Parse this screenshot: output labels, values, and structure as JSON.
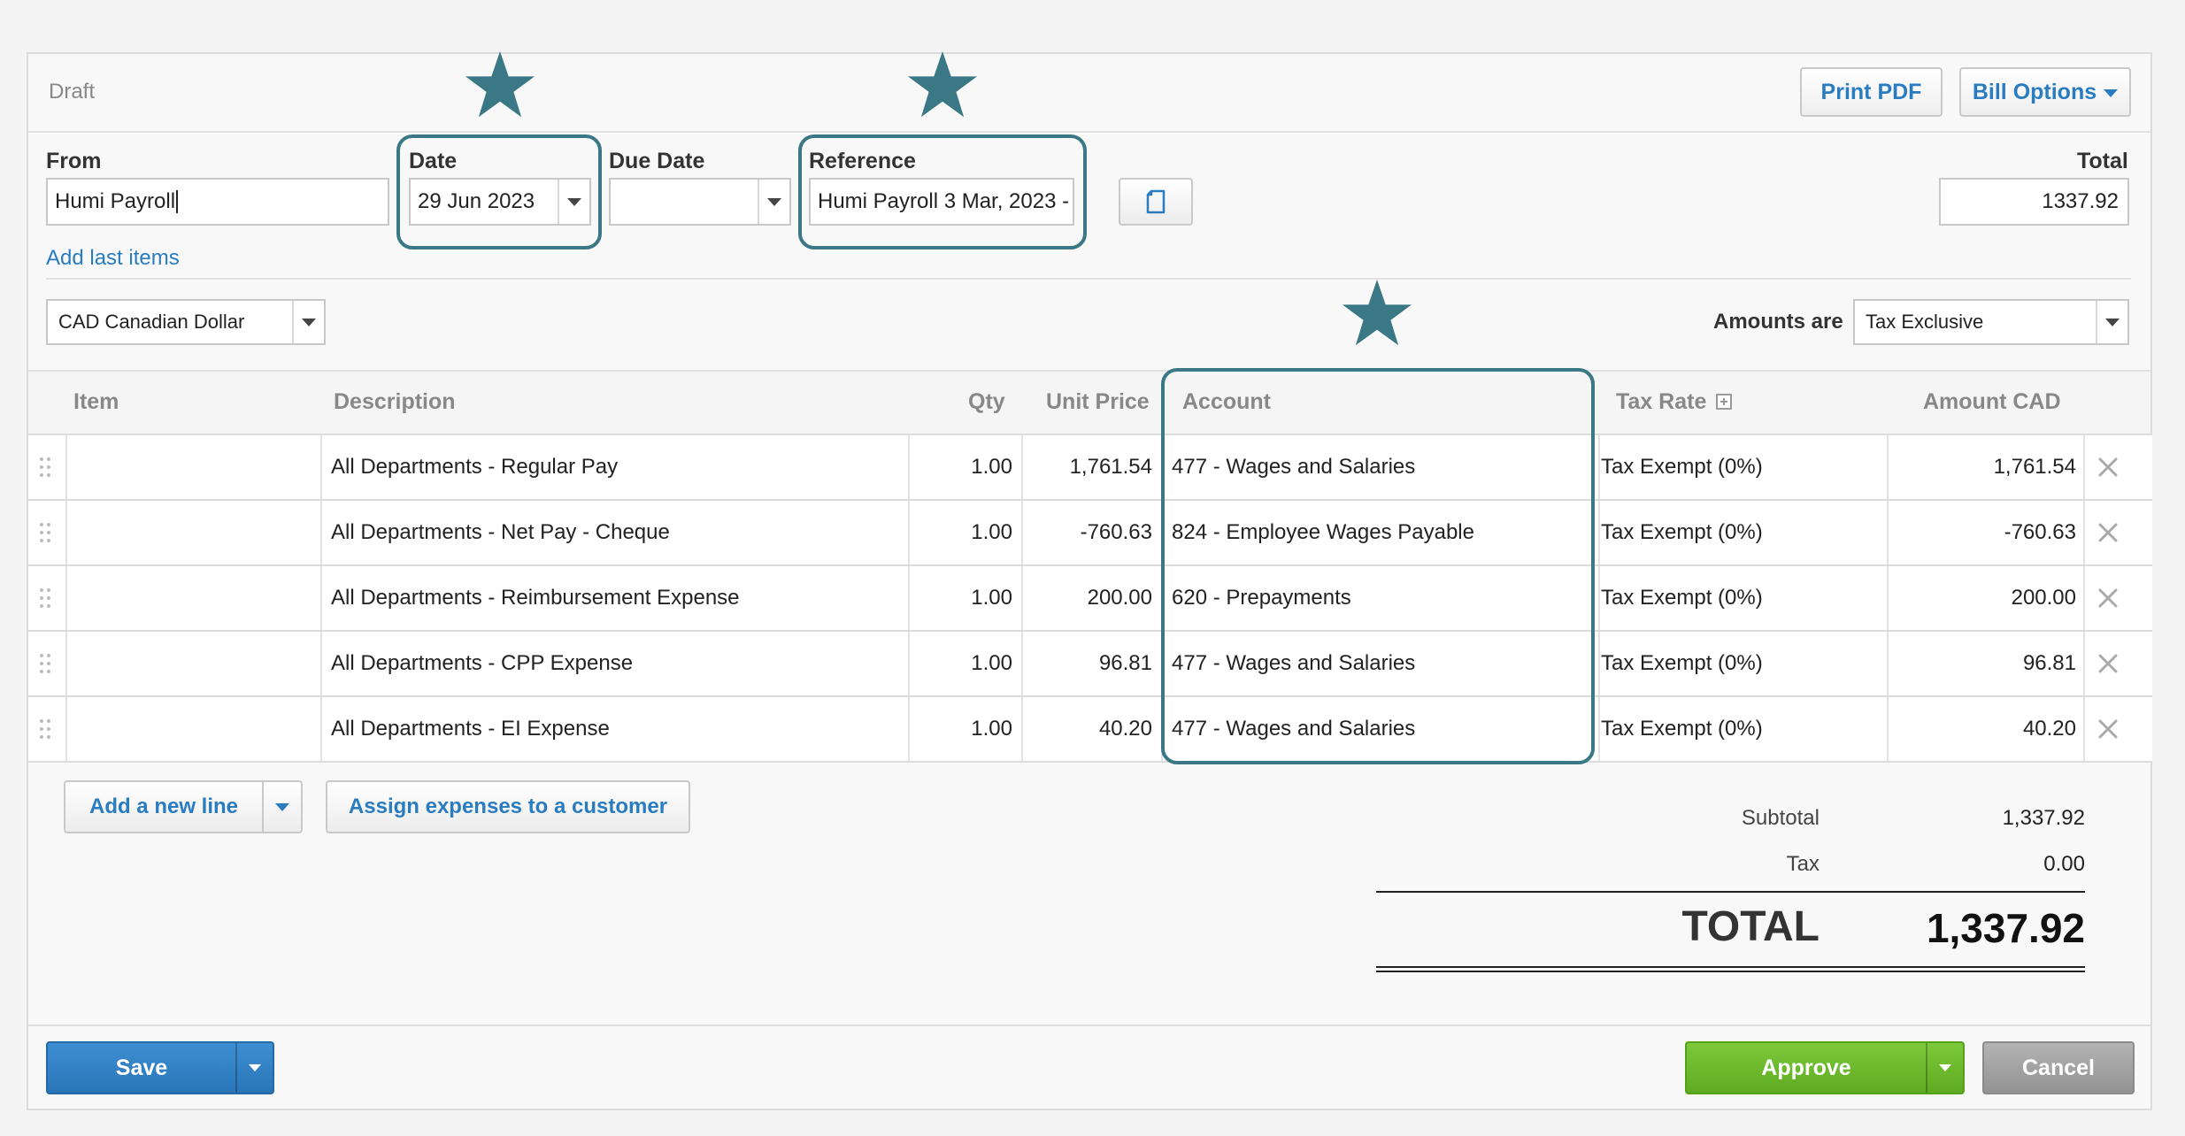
{
  "header": {
    "status": "Draft",
    "print_pdf": "Print PDF",
    "bill_options": "Bill Options"
  },
  "form": {
    "from_label": "From",
    "from_value": "Humi Payroll",
    "date_label": "Date",
    "date_value": "29 Jun 2023",
    "due_date_label": "Due Date",
    "due_date_value": "",
    "reference_label": "Reference",
    "reference_value": "Humi Payroll 3 Mar, 2023 -",
    "total_label": "Total",
    "total_value": "1337.92",
    "add_last_items": "Add last items",
    "currency": "CAD Canadian Dollar",
    "amounts_are_label": "Amounts are",
    "amounts_are_value": "Tax Exclusive"
  },
  "table": {
    "headers": {
      "item": "Item",
      "description": "Description",
      "qty": "Qty",
      "unit_price": "Unit Price",
      "account": "Account",
      "tax_rate": "Tax Rate",
      "amount": "Amount CAD"
    },
    "rows": [
      {
        "item": "",
        "description": "All Departments - Regular Pay",
        "qty": "1.00",
        "unit_price": "1,761.54",
        "account": "477 - Wages and Salaries",
        "tax_rate": "Tax Exempt (0%)",
        "amount": "1,761.54"
      },
      {
        "item": "",
        "description": "All Departments - Net Pay - Cheque",
        "qty": "1.00",
        "unit_price": "-760.63",
        "account": "824 - Employee Wages Payable",
        "tax_rate": "Tax Exempt (0%)",
        "amount": "-760.63"
      },
      {
        "item": "",
        "description": "All Departments - Reimbursement Expense",
        "qty": "1.00",
        "unit_price": "200.00",
        "account": "620 - Prepayments",
        "tax_rate": "Tax Exempt (0%)",
        "amount": "200.00"
      },
      {
        "item": "",
        "description": "All Departments - CPP Expense",
        "qty": "1.00",
        "unit_price": "96.81",
        "account": "477 - Wages and Salaries",
        "tax_rate": "Tax Exempt (0%)",
        "amount": "96.81"
      },
      {
        "item": "",
        "description": "All Departments - EI Expense",
        "qty": "1.00",
        "unit_price": "40.20",
        "account": "477 - Wages and Salaries",
        "tax_rate": "Tax Exempt (0%)",
        "amount": "40.20"
      }
    ]
  },
  "actions": {
    "add_new_line": "Add a new line",
    "assign_expenses": "Assign expenses to a customer"
  },
  "totals": {
    "subtotal_label": "Subtotal",
    "subtotal_value": "1,337.92",
    "tax_label": "Tax",
    "tax_value": "0.00",
    "total_label": "TOTAL",
    "total_value": "1,337.92"
  },
  "footer": {
    "save": "Save",
    "approve": "Approve",
    "cancel": "Cancel"
  },
  "colors": {
    "highlight": "#3a7885",
    "link": "#2a7cc1",
    "save": "#2f7fc2",
    "approve": "#6cb82d",
    "cancel": "#9a9a9a"
  },
  "icons": [
    "star-icon",
    "copy-icon",
    "drag-handle-icon",
    "remove-icon",
    "chevron-down-icon",
    "expand-icon"
  ]
}
